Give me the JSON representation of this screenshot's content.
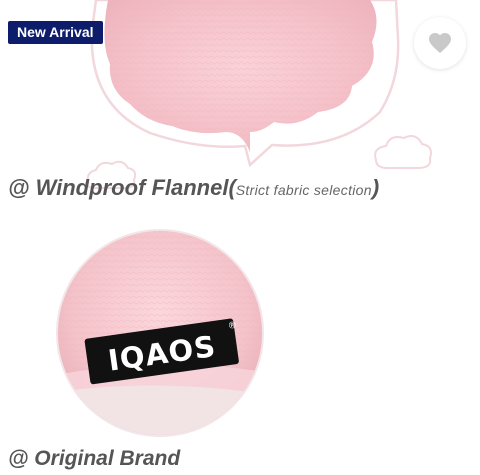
{
  "badge": {
    "label": "New Arrival"
  },
  "favorite": {
    "icon": "heart-icon"
  },
  "captions": {
    "fabric_prefix": "@ Windproof Flannel(",
    "fabric_detail": "Strict fabric selection",
    "fabric_suffix": ")",
    "brand": "@ Original Brand"
  },
  "brand_label": {
    "text": "IQAOS",
    "mark": "®"
  },
  "colors": {
    "badge_bg": "#0d1d6b",
    "fabric_pink": "#f6c4cc",
    "caption_gray": "#555555",
    "outline_pink": "#f2d7dc"
  }
}
